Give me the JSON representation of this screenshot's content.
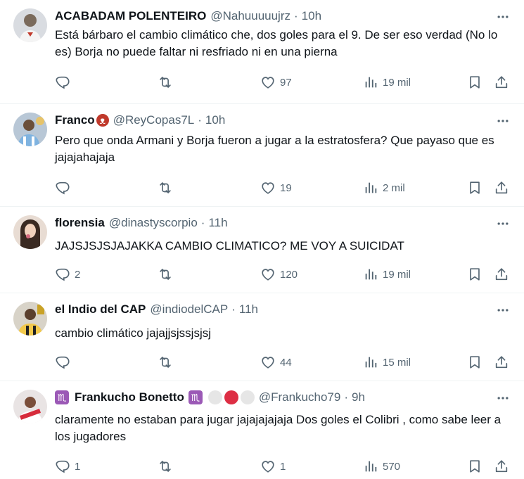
{
  "colors": {
    "text": "#0f1419",
    "secondary": "#536471",
    "divider": "#eff3f4"
  },
  "tweets": [
    {
      "name": "ACABADAM POLENTEIRO",
      "handle": "@Nahuuuuujrz",
      "separator": "·",
      "time": "10h",
      "text": "Está bárbaro el cambio climático che, dos goles para el 9. De ser eso verdad (No lo es) Borja no puede faltar ni resfriado ni en una pierna",
      "replies": "",
      "reposts": "",
      "likes": "97",
      "views": "19 mil"
    },
    {
      "name": "Franco",
      "handle": "@ReyCopas7L",
      "separator": "·",
      "time": "10h",
      "text": "Pero que onda Armani y Borja fueron a jugar a la estratosfera? Que payaso que es jajajahajaja",
      "replies": "",
      "reposts": "",
      "likes": "19",
      "views": "2 mil"
    },
    {
      "name": "florensia",
      "handle": "@dinastyscorpio",
      "separator": "·",
      "time": "11h",
      "text": "JAJSJSJSJAJAKKA CAMBIO CLIMATICO? ME VOY A SUICIDAT",
      "replies": "2",
      "reposts": "",
      "likes": "120",
      "views": "19 mil"
    },
    {
      "name": "el Indio del CAP",
      "handle": "@indiodelCAP",
      "separator": "·",
      "time": "11h",
      "text": "cambio climático jajajjsjssjsjsj",
      "replies": "",
      "reposts": "",
      "likes": "44",
      "views": "15 mil"
    },
    {
      "name": "Frankucho Bonetto",
      "handle": "@Frankucho79",
      "separator": "·",
      "time": "9h",
      "text": "claramente no estaban para jugar jajajajajaja Dos goles el Colibri , como sabe leer a los jugadores",
      "replies": "1",
      "reposts": "",
      "likes": "1",
      "views": "570"
    }
  ]
}
